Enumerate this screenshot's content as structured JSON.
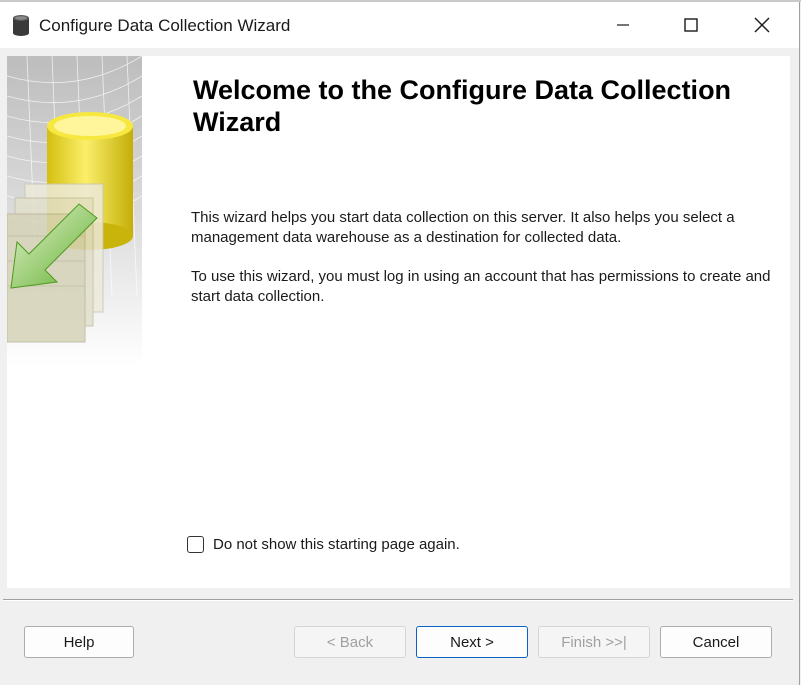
{
  "window": {
    "title": "Configure Data Collection Wizard",
    "icon": "database-icon"
  },
  "page": {
    "heading": "Welcome to the Configure Data Collection Wizard",
    "paragraphs": [
      "This wizard helps you start data collection on this server. It also helps you select a management data warehouse as a destination for collected data.",
      "To use this wizard, you must log in using an account that has permissions to create and start data collection."
    ],
    "checkbox": {
      "label": "Do not show this starting page again.",
      "checked": false
    }
  },
  "buttons": {
    "help": "Help",
    "back": "< Back",
    "next": "Next >",
    "finish": "Finish >>|",
    "cancel": "Cancel"
  },
  "colors": {
    "accent_border": "#0a64c8",
    "cylinder": "#f0dc3c",
    "arrow": "#7cc24a"
  }
}
